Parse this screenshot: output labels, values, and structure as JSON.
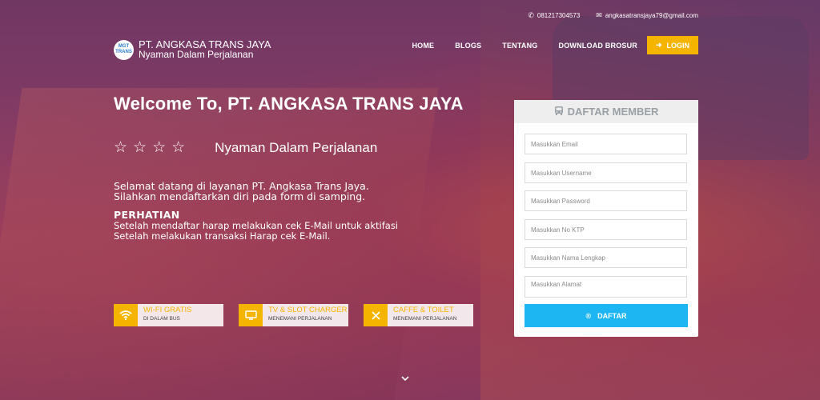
{
  "contact": {
    "phone": "081217304573",
    "email": "angkasatransjaya79@gmail.com"
  },
  "brand": {
    "logo_text": "MGT TRANS",
    "name": "PT. ANGKASA TRANS JAYA",
    "tagline": "Nyaman Dalam Perjalanan"
  },
  "nav": {
    "items": [
      "HOME",
      "BLOGS",
      "TENTANG",
      "DOWNLOAD BROSUR"
    ],
    "login_label": "LOGIN"
  },
  "hero": {
    "title": "Welcome To, PT. ANGKASA TRANS JAYA",
    "stars": "☆☆☆☆",
    "slogan": "Nyaman Dalam Perjalanan",
    "intro_line1": "Selamat datang di layanan PT. Angkasa Trans Jaya.",
    "intro_line2": "Silahkan mendaftarkan diri pada form di samping.",
    "notice_heading": "PERHATIAN",
    "notice_line1": "Setelah mendaftar harap melakukan cek E-Mail untuk aktifasi",
    "notice_line2": "Setelah melakukan transaksi Harap cek E-Mail."
  },
  "features": [
    {
      "icon": "wifi-icon",
      "title": "WI-FI GRATIS",
      "subtitle": "DI DALAM BUS"
    },
    {
      "icon": "tv-icon",
      "title": "TV & SLOT CHARGER",
      "subtitle": "MENEMANI PERJALANAN"
    },
    {
      "icon": "cutlery-icon",
      "title": "CAFFE & TOILET",
      "subtitle": "MENEMANI PERJALANAN"
    }
  ],
  "register": {
    "title": "DAFTAR MEMBER",
    "fields": {
      "email": "Masukkan Email",
      "username": "Masukkan Username",
      "password": "Masukkan Password",
      "ktp": "Masukkan No KTP",
      "fullname": "Masukkan Nama Lengkap",
      "address": "Masukkan Alamat"
    },
    "submit_label": "DAFTAR"
  },
  "colors": {
    "accent": "#f5b400",
    "submit": "#1db6f2",
    "panel_head": "#eeeeee"
  }
}
